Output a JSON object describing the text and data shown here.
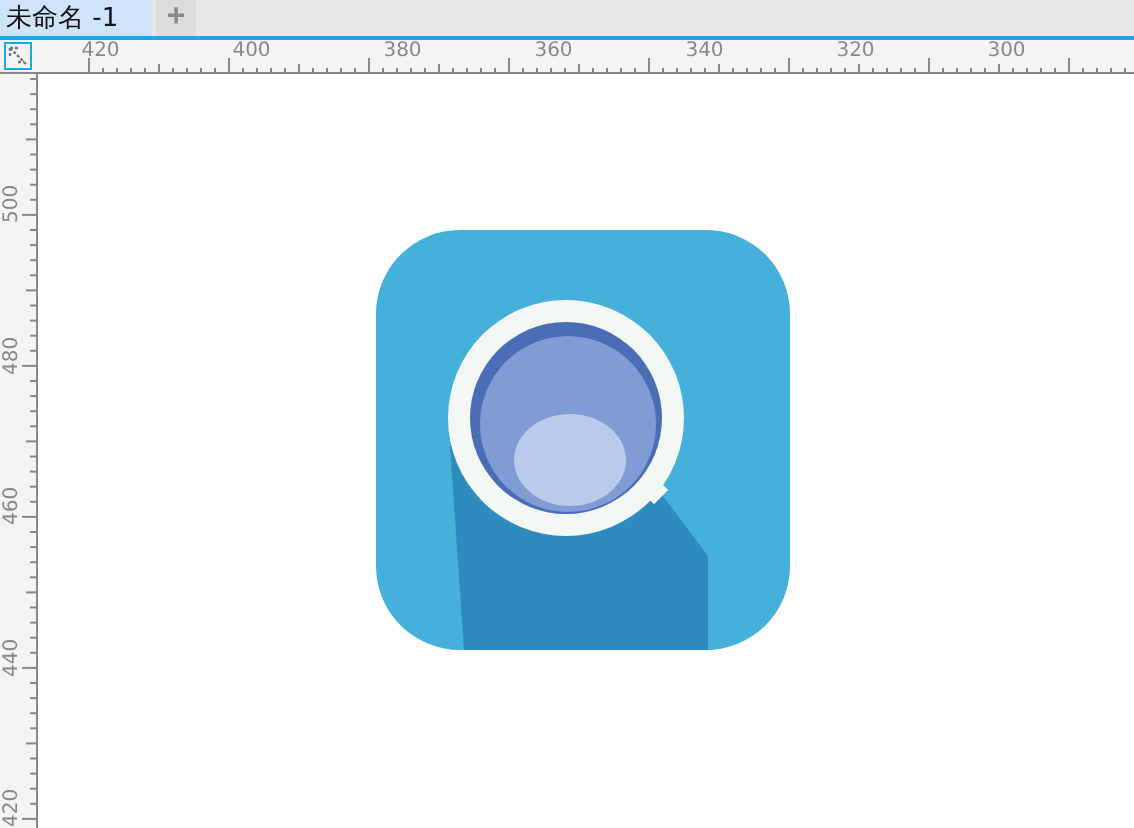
{
  "tabs": [
    {
      "label": "未命名 -1",
      "selected": true
    },
    {
      "label": "+",
      "selected": false
    }
  ],
  "top_ruler": {
    "labels": [
      "420",
      "400",
      "380",
      "360",
      "340",
      "320",
      "300"
    ]
  },
  "left_ruler": {
    "labels": [
      "500",
      "480",
      "460",
      "440",
      "420"
    ]
  }
}
